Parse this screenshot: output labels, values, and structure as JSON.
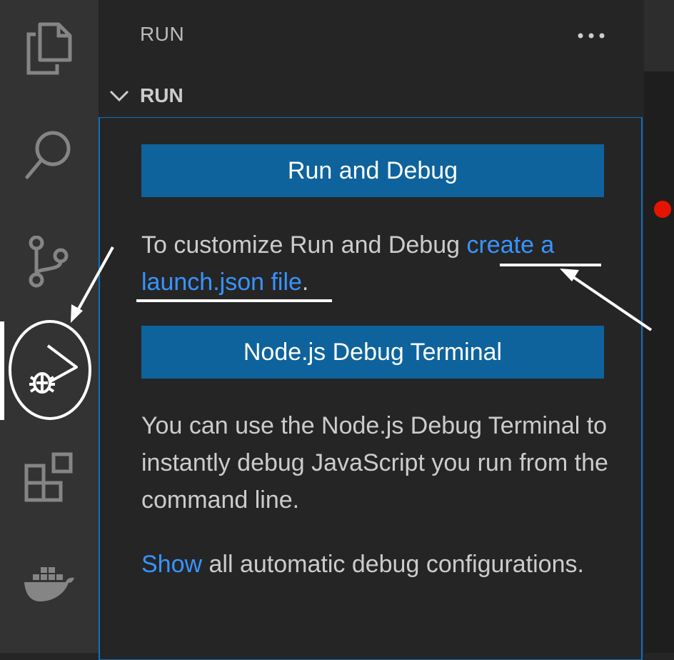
{
  "activity_bar": {
    "items": [
      {
        "icon": "files-icon",
        "label": "Explorer"
      },
      {
        "icon": "search-icon",
        "label": "Search"
      },
      {
        "icon": "source-control-icon",
        "label": "Source Control"
      },
      {
        "icon": "run-debug-icon",
        "label": "Run",
        "active": true
      },
      {
        "icon": "extensions-icon",
        "label": "Extensions"
      },
      {
        "icon": "docker-icon",
        "label": "Docker"
      }
    ]
  },
  "sidebar": {
    "title": "RUN",
    "more_icon": "ellipsis-icon",
    "section": {
      "chevron_icon": "chevron-down-icon",
      "label": "RUN"
    },
    "run_button_label": "Run and Debug",
    "customize_text": "To customize Run and Debug ",
    "create_link": "create a launch.json file",
    "customize_suffix": ".",
    "node_button_label": "Node.js Debug Terminal",
    "node_description": "You can use the Node.js Debug Terminal to instantly debug JavaScript you run from the command line.",
    "show_link": "Show",
    "show_suffix": " all automatic debug configurations."
  },
  "colors": {
    "activity_bg": "#333333",
    "sidebar_bg": "#252526",
    "button_bg": "#0e639c",
    "link": "#3794ff",
    "focus_border": "#0e71c0",
    "breakpoint": "#e51400"
  }
}
